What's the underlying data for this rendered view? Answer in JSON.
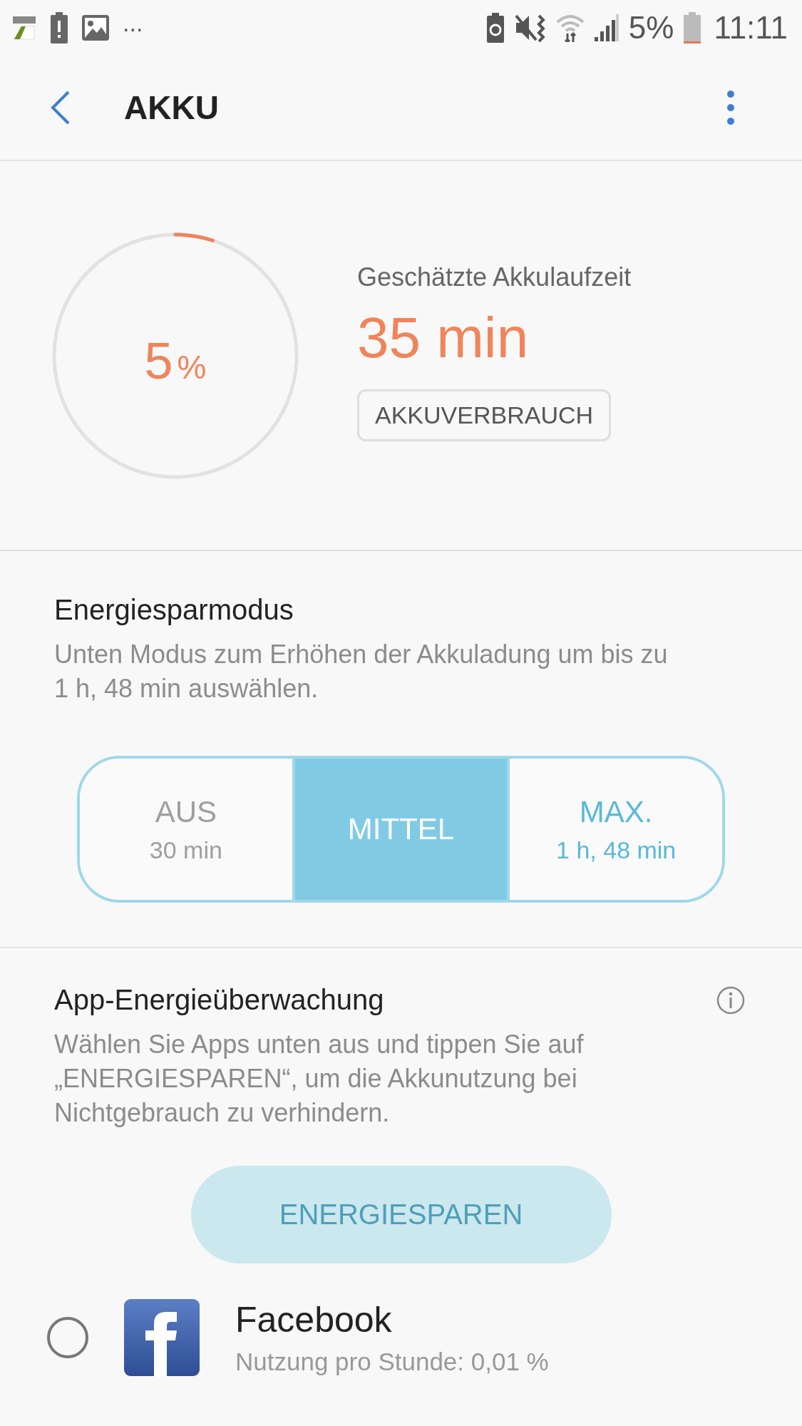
{
  "status_bar": {
    "left_more": "...",
    "battery_text": "5%",
    "time": "11:11"
  },
  "app_bar": {
    "title": "AKKU"
  },
  "battery": {
    "level": 0.05,
    "percent_value": "5",
    "percent_sign": "%",
    "estimate_label": "Geschätzte Akkulaufzeit",
    "estimate": "35 min",
    "usage_button": "AKKUVERBRAUCH"
  },
  "power_saving": {
    "title": "Energiesparmodus",
    "description": "Unten Modus zum Erhöhen der Akkuladung um bis zu 1 h, 48 min auswählen.",
    "modes": [
      {
        "label": "AUS",
        "sub": "30 min",
        "selected": false,
        "kind": "plain"
      },
      {
        "label": "MITTEL",
        "selected": true,
        "kind": "plain"
      },
      {
        "label": "MAX.",
        "sub": "1 h, 48 min",
        "selected": false,
        "kind": "accent"
      }
    ]
  },
  "app_monitor": {
    "title": "App-Energieüberwachung",
    "description": "Wählen Sie Apps unten aus und tippen Sie auf „ENERGIESPAREN“, um die Akkunutzung bei Nichtgebrauch zu verhindern.",
    "save_button": {
      "label": "ENERGIESPAREN",
      "disabled": true
    },
    "apps": [
      {
        "name": "Facebook",
        "usage": "Nutzung pro Stunde: 0,01 %",
        "selected": false
      }
    ]
  }
}
